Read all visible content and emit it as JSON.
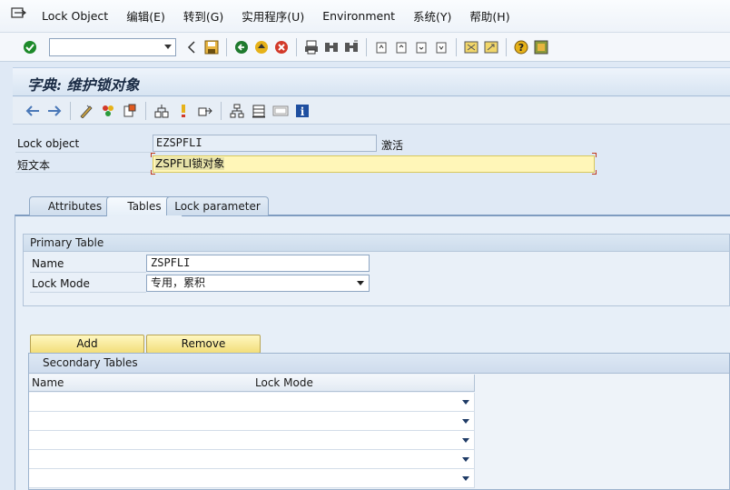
{
  "menu": {
    "items": [
      "Lock Object",
      "编辑(E)",
      "转到(G)",
      "实用程序(U)",
      "Environment",
      "系统(Y)",
      "帮助(H)"
    ]
  },
  "title": "字典: 维护锁对象",
  "form": {
    "lock_object_label": "Lock object",
    "lock_object_value": "EZSPFLI",
    "status": "激活",
    "short_text_label": "短文本",
    "short_text_value": "ZSPFLI锁对象"
  },
  "tabs": [
    {
      "label": "Attributes",
      "active": false
    },
    {
      "label": "Tables",
      "active": true
    },
    {
      "label": "Lock parameter",
      "active": false
    }
  ],
  "primary_table": {
    "title": "Primary Table",
    "name_label": "Name",
    "name_value": "ZSPFLI",
    "lock_mode_label": "Lock Mode",
    "lock_mode_value": "专用，累积"
  },
  "buttons": {
    "add": "Add",
    "remove": "Remove"
  },
  "secondary_tables": {
    "title": "Secondary Tables",
    "columns": [
      "Name",
      "Lock Mode"
    ],
    "rows": [
      {
        "name": "",
        "lock_mode": ""
      },
      {
        "name": "",
        "lock_mode": ""
      },
      {
        "name": "",
        "lock_mode": ""
      },
      {
        "name": "",
        "lock_mode": ""
      },
      {
        "name": "",
        "lock_mode": ""
      }
    ]
  },
  "colors": {
    "accent": "#7f9cc0",
    "button_yellow": "#f2de7a",
    "required_field": "#fff6b8"
  },
  "icons": {
    "toolbar": [
      "enter-icon",
      "back-icon",
      "save-icon",
      "back-green-icon",
      "exit-icon",
      "cancel-icon",
      "print-icon",
      "find-icon",
      "find-next-icon",
      "first-page-icon",
      "prev-page-icon",
      "next-page-icon",
      "last-page-icon",
      "new-session-icon",
      "shortcut-icon",
      "help-icon",
      "customize-icon"
    ],
    "app": [
      "previous-object-icon",
      "next-object-icon",
      "display-change-icon",
      "check-icon",
      "activate-icon",
      "where-used-icon",
      "object-list-icon",
      "navigation-icon",
      "hierarchy-icon",
      "table-icon",
      "frame-icon",
      "info-icon"
    ]
  }
}
